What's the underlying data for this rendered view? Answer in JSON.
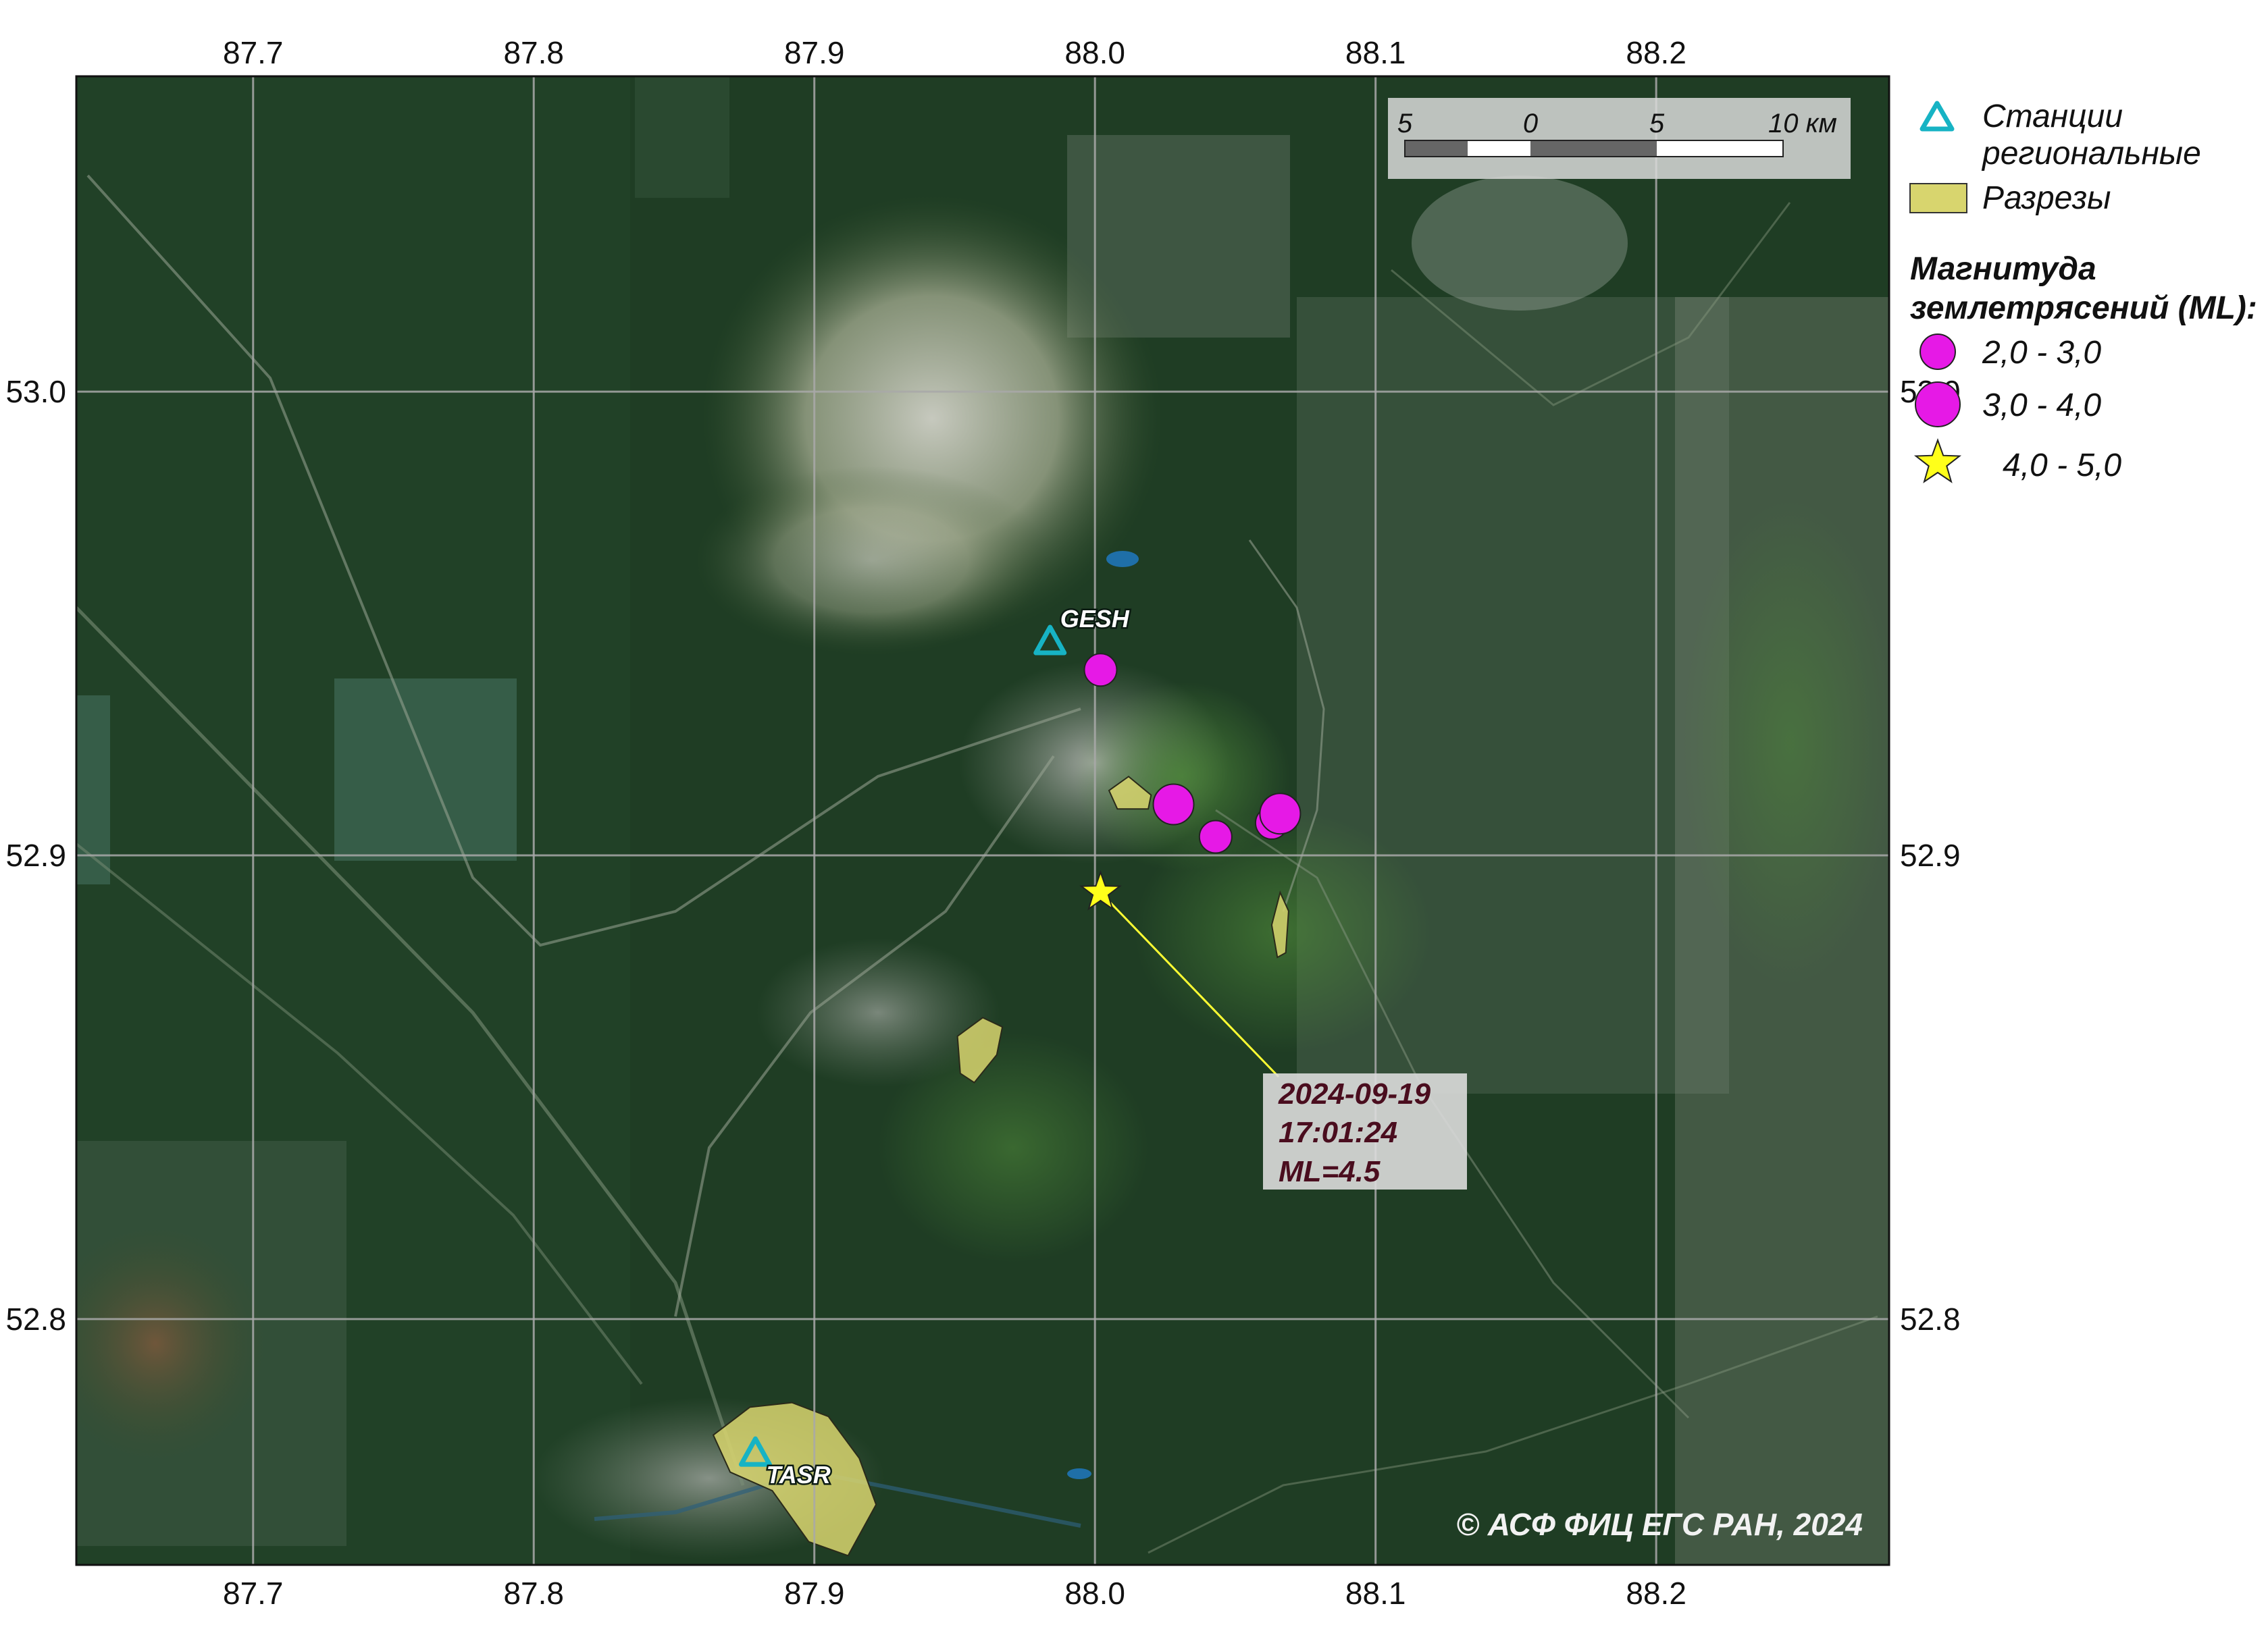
{
  "axes": {
    "lon_ticks": [
      "87.7",
      "87.8",
      "87.9",
      "88.0",
      "88.1",
      "88.2"
    ],
    "lat_ticks": [
      "53.0",
      "52.9",
      "52.8"
    ],
    "lon_range": [
      87.637,
      88.283
    ],
    "lat_range": [
      52.747,
      53.068
    ]
  },
  "scale_bar": {
    "labels": [
      "5",
      "0",
      "5",
      "10 км"
    ]
  },
  "stations": [
    {
      "code": "GESH",
      "lon": 87.984,
      "lat": 52.946
    },
    {
      "code": "TASR",
      "lon": 87.879,
      "lat": 52.771
    }
  ],
  "quarries": [
    {
      "name": "quarry-1",
      "points": [
        [
          88.005,
          52.914
        ],
        [
          88.012,
          52.917
        ],
        [
          88.02,
          52.913
        ],
        [
          88.019,
          52.91
        ],
        [
          88.008,
          52.91
        ]
      ]
    },
    {
      "name": "quarry-2",
      "points": [
        [
          88.063,
          52.885
        ],
        [
          88.066,
          52.892
        ],
        [
          88.069,
          52.888
        ],
        [
          88.068,
          52.879
        ],
        [
          88.065,
          52.878
        ]
      ]
    },
    {
      "name": "quarry-3",
      "points": [
        [
          87.951,
          52.861
        ],
        [
          87.96,
          52.865
        ],
        [
          87.967,
          52.863
        ],
        [
          87.965,
          52.857
        ],
        [
          87.957,
          52.851
        ],
        [
          87.952,
          52.853
        ]
      ]
    },
    {
      "name": "quarry-4",
      "points": [
        [
          87.864,
          52.775
        ],
        [
          87.877,
          52.781
        ],
        [
          87.892,
          52.782
        ],
        [
          87.905,
          52.779
        ],
        [
          87.916,
          52.77
        ],
        [
          87.922,
          52.76
        ],
        [
          87.912,
          52.749
        ],
        [
          87.898,
          52.752
        ],
        [
          87.885,
          52.763
        ],
        [
          87.87,
          52.767
        ]
      ]
    }
  ],
  "earthquakes": [
    {
      "lon": 88.002,
      "lat": 52.94,
      "ml_class": "2.0-3.0"
    },
    {
      "lon": 88.028,
      "lat": 52.911,
      "ml_class": "3.0-4.0"
    },
    {
      "lon": 88.043,
      "lat": 52.904,
      "ml_class": "2.0-3.0"
    },
    {
      "lon": 88.063,
      "lat": 52.907,
      "ml_class": "2.0-3.0"
    },
    {
      "lon": 88.066,
      "lat": 52.909,
      "ml_class": "3.0-4.0"
    },
    {
      "lon": 88.002,
      "lat": 52.892,
      "ml_class": "4.0-5.0"
    }
  ],
  "annotation": {
    "lines": [
      "2024-09-19",
      "17:01:24",
      "ML=4.5"
    ]
  },
  "copyright": "© АСФ ФИЦ ЕГС РАН, 2024",
  "legend": {
    "stations_label_1": "Станции",
    "stations_label_2": "региональные",
    "quarries_label": "Разрезы",
    "magnitude_title_1": "Магнитуда",
    "magnitude_title_2": "землетрясений (ML):",
    "classes": [
      "2,0 - 3,0",
      "3,0 - 4,0",
      "4,0 - 5,0"
    ]
  },
  "colors": {
    "station": "#17b3c4",
    "quarry_fill": "#d8d56e",
    "quake": "#e619e6",
    "star": "#ffff1a",
    "grid": "#a9a9a9",
    "leader": "#ffff33"
  }
}
